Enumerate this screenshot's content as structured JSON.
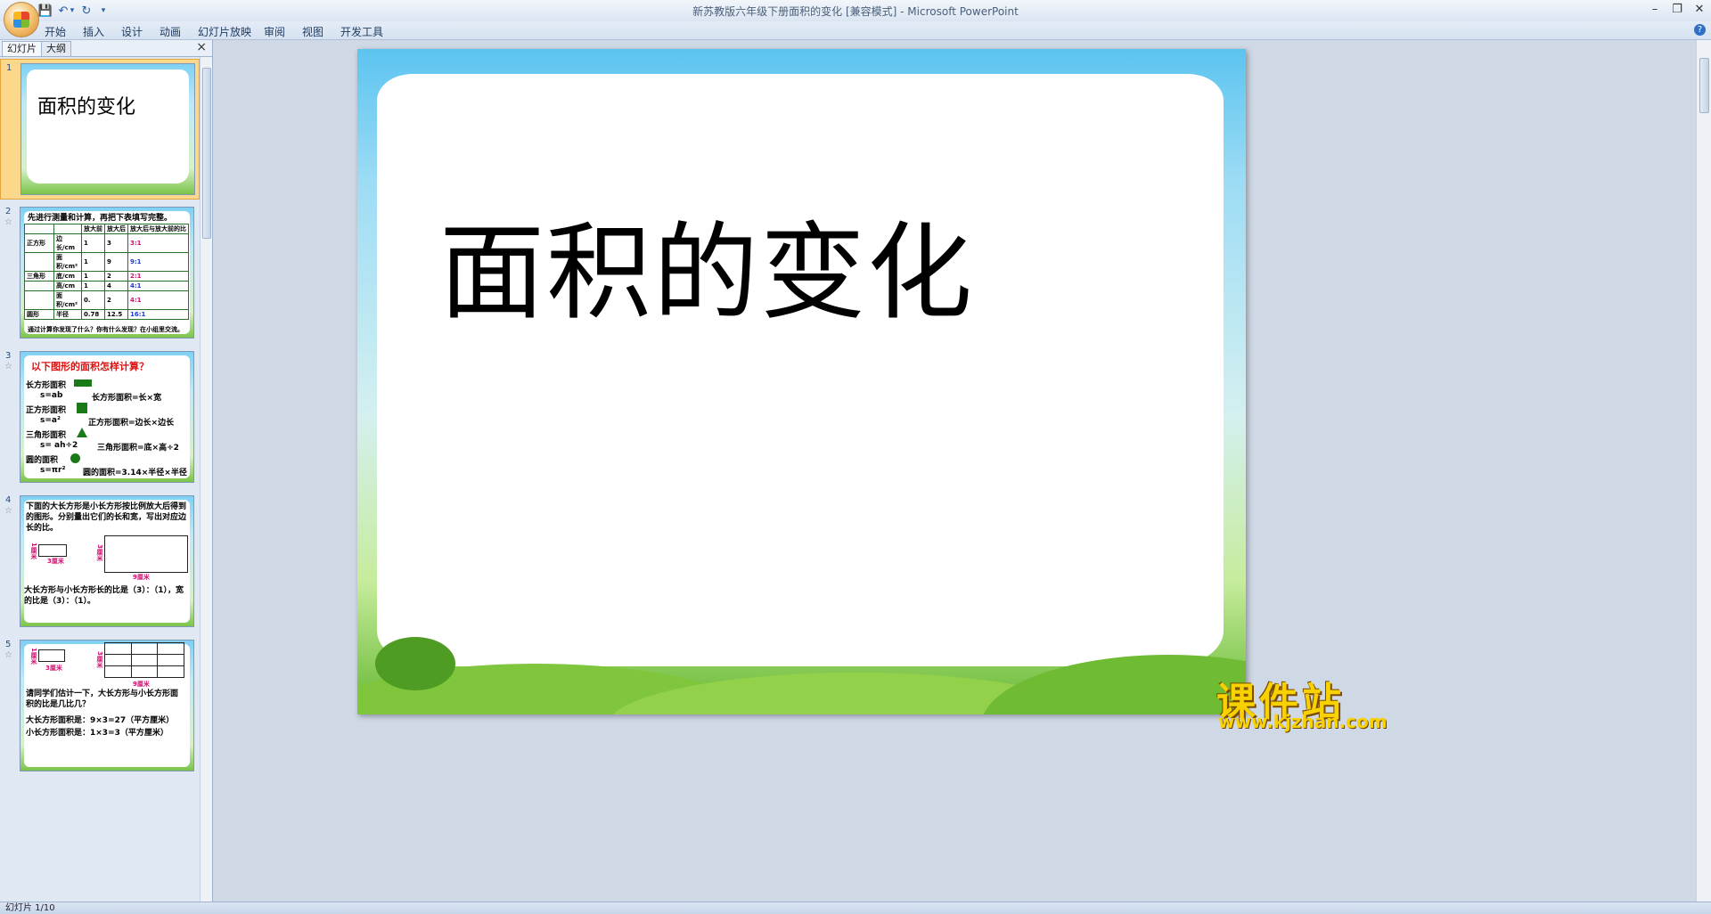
{
  "window": {
    "title": "新苏教版六年级下册面积的变化 [兼容模式] - Microsoft PowerPoint"
  },
  "ribbon": {
    "tabs": [
      "开始",
      "插入",
      "设计",
      "动画",
      "幻灯片放映",
      "审阅",
      "视图",
      "开发工具"
    ]
  },
  "left_pane": {
    "tabs": [
      "幻灯片",
      "大纲"
    ],
    "close": "×"
  },
  "thumbnails": {
    "s1": {
      "num": "1",
      "title": "面积的变化"
    },
    "s2": {
      "num": "2",
      "heading": "先进行测量和计算，再把下表填写完整。",
      "col_headers": [
        "放大前",
        "放大后",
        "放大后与放大前的比"
      ],
      "rows": [
        {
          "group": "正方形",
          "item": "边长/cm",
          "before": "1",
          "after": "3",
          "ratio": "3:1"
        },
        {
          "group": "",
          "item": "面积/cm²",
          "before": "1",
          "after": "9",
          "ratio": "9:1"
        },
        {
          "group": "三角形",
          "item": "底/cm",
          "before": "1",
          "after": "2",
          "ratio": "2:1"
        },
        {
          "group": "",
          "item": "高/cm",
          "before": "1",
          "after": "4",
          "ratio": "4:1"
        },
        {
          "group": "",
          "item": "面积/cm²",
          "before": "0.",
          "after": "2",
          "ratio": "4:1"
        },
        {
          "group": "圆形",
          "item": "半径",
          "before": "0.78",
          "after": "12.5",
          "ratio": "16:1"
        }
      ],
      "footer": "通过计算你发现了什么？你有什么发现？在小组里交流。"
    },
    "s3": {
      "num": "3",
      "heading": "以下图形的面积怎样计算？",
      "lines": [
        "长方形面积",
        "s=ab",
        "长方形面积=长×宽",
        "正方形面积",
        "s=a²",
        "正方形面积=边长×边长",
        "三角形面积",
        "s= ah÷2",
        "三角形面积=底×高÷2",
        "圆的面积",
        "s=πr²",
        "圆的面积=3.14×半径×半径"
      ]
    },
    "s4": {
      "num": "4",
      "text1": "下面的大长方形是小长方形按比例放大后得到的图形。分别量出它们的长和宽，写出对应边长的比。",
      "label_small_w": "3厘米",
      "label_small_h": "1厘米",
      "label_big_w": "9厘米",
      "label_big_h": "3厘米",
      "text2": "大长方形与小长方形长的比是（3）：（1），宽的比是（3）：（1）。"
    },
    "s5": {
      "num": "5",
      "label_small_w": "3厘米",
      "label_small_h": "1厘米",
      "label_big_w": "9厘米",
      "label_big_h": "3厘米",
      "q": "请同学们估计一下，大长方形与小长方形面积的比是几比几？",
      "a1": "大长方形面积是：9×3=27（平方厘米）",
      "a2": "小长方形面积是：1×3=3（平方厘米）"
    }
  },
  "slide": {
    "title": "面积的变化"
  },
  "status": {
    "text": "幻灯片 1/10"
  },
  "watermark": {
    "main": "课件站",
    "url": "www.kjzhan.com"
  }
}
